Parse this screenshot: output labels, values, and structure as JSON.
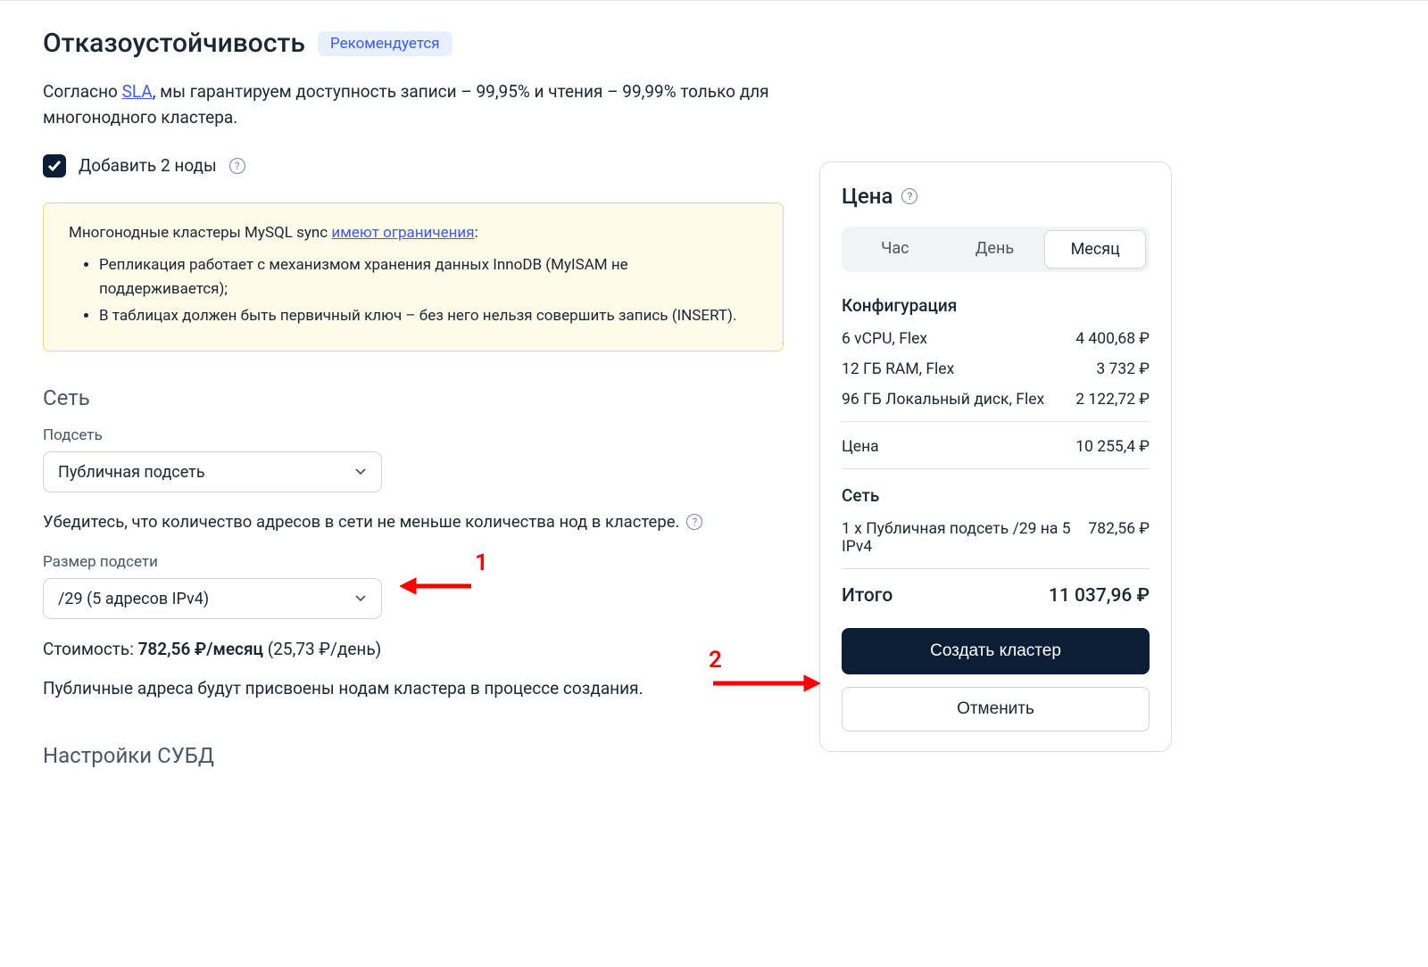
{
  "ha": {
    "title": "Отказоустойчивость",
    "badge": "Рекомендуется",
    "desc_prefix": "Согласно ",
    "sla_link": "SLA",
    "desc_suffix": ", мы гарантируем доступность записи – 99,95% и чтения – 99,99% только для многонодного кластера.",
    "checkbox_label": "Добавить 2 ноды",
    "info_intro_prefix": "Многонодные кластеры MySQL sync ",
    "info_link": "имеют ограничения",
    "info_colon": ":",
    "info_li1": "Репликация работает с механизмом хранения данных InnoDB (MyISAM не поддерживается);",
    "info_li2": "В таблицах должен быть первичный ключ – без него нельзя совершить запись (INSERT)."
  },
  "network": {
    "title": "Сеть",
    "subnet_label": "Подсеть",
    "subnet_value": "Публичная подсеть",
    "hint": "Убедитесь, что количество адресов в сети не меньше количества нод в кластере.",
    "size_label": "Размер подсети",
    "size_value": "/29 (5 адресов IPv4)",
    "cost_prefix": "Стоимость: ",
    "cost_bold": "782,56 ₽/месяц",
    "cost_suffix": " (25,73 ₽/день)",
    "note": "Публичные адреса будут присвоены нодам кластера в процессе создания."
  },
  "dbms": {
    "title": "Настройки СУБД"
  },
  "annotations": {
    "a1": "1",
    "a2": "2"
  },
  "price": {
    "title": "Цена",
    "tabs": {
      "hour": "Час",
      "day": "День",
      "month": "Месяц"
    },
    "config_title": "Конфигурация",
    "rows": [
      {
        "name": "6 vCPU, Flex",
        "val": "4 400,68 ₽"
      },
      {
        "name": "12 ГБ RAM, Flex",
        "val": "3 732 ₽"
      },
      {
        "name": "96 ГБ Локальный диск, Flex",
        "val": "2 122,72 ₽"
      }
    ],
    "subtotal": {
      "name": "Цена",
      "val": "10 255,4 ₽"
    },
    "net_title": "Сеть",
    "net_row": {
      "name": "1 x Публичная подсеть /29 на 5 IPv4",
      "val": "782,56 ₽"
    },
    "total_label": "Итого",
    "total_val": "11 037,96 ₽",
    "create": "Создать кластер",
    "cancel": "Отменить"
  }
}
